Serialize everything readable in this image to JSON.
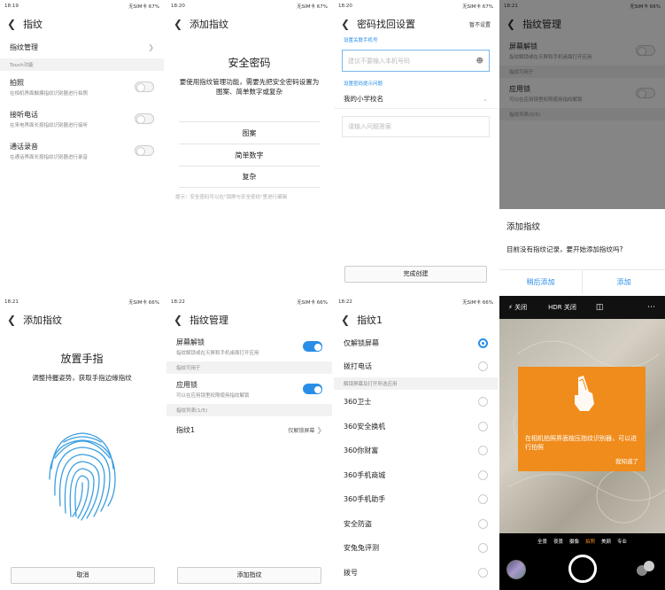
{
  "p1": {
    "time": "18:19",
    "status": "无SIM卡 67%",
    "title": "指纹",
    "item_manage": "指纹管理",
    "section_touch": "Touch功能",
    "items": [
      {
        "label": "拍照",
        "sub": "在相机界面触摸指纹识别器进行拍照"
      },
      {
        "label": "接听电话",
        "sub": "在来电界面长按指纹识别器进行接听"
      },
      {
        "label": "通话录音",
        "sub": "在通话界面长按指纹识别器进行录音"
      }
    ]
  },
  "p2": {
    "time": "18:20",
    "status": "无SIM卡 67%",
    "title": "添加指纹",
    "heading": "安全密码",
    "desc": "要使用指纹管理功能，需要先把安全密码设置为图案、简单数字或复杂",
    "options": [
      "图案",
      "简单数字",
      "复杂"
    ],
    "hint": "提示：安全密码可以在\"锁屏与安全密码\"里进行编辑"
  },
  "p3": {
    "time": "18:20",
    "status": "无SIM卡 67%",
    "title": "密码找回设置",
    "skip": "暂不设置",
    "phone_label": "设置关联手机号",
    "phone_placeholder": "建议不要输入本机号码",
    "question_label": "设置密码提示问题",
    "question_value": "我的小学校名",
    "answer_placeholder": "请输入问题答案",
    "done": "完成创建"
  },
  "p4": {
    "time": "18:21",
    "status": "无SIM卡 66%",
    "title": "指纹管理",
    "row1": {
      "label": "屏幕解锁",
      "sub": "指纹解锁或在灭屏和手机桌面打开应用"
    },
    "section1": "指纹可用于",
    "row2": {
      "label": "应用锁",
      "sub": "可以在应用锁里权限使用指纹解锁"
    },
    "section2": "指纹列表(0/5)",
    "dialog_title": "添加指纹",
    "dialog_msg": "目前没有指纹记录，要开始添加指纹吗?",
    "later": "稍后添加",
    "add": "添加"
  },
  "p5": {
    "time": "18:21",
    "status": "无SIM卡 66%",
    "title": "添加指纹",
    "heading": "放置手指",
    "desc": "调整持握姿势，获取手指边缘指纹",
    "cancel": "取消"
  },
  "p6": {
    "time": "18:22",
    "status": "无SIM卡 66%",
    "title": "指纹管理",
    "row1": {
      "label": "屏幕解锁",
      "sub": "指纹解锁或在灭屏和手机桌面打开应用"
    },
    "section1": "指纹可用于",
    "row2": {
      "label": "应用锁",
      "sub": "可以在应用锁里权限使用指纹解锁"
    },
    "section2": "指纹列表(1/5)",
    "fp_name": "指纹1",
    "fp_value": "仅解锁屏幕",
    "add": "添加指纹"
  },
  "p7": {
    "time": "18:22",
    "status": "无SIM卡 66%",
    "title": "指纹1",
    "top": [
      "仅解锁屏幕",
      "拨打电话"
    ],
    "section": "解锁屏幕及打开所选应用",
    "apps": [
      "360卫士",
      "360安全换机",
      "360你财富",
      "360手机商城",
      "360手机助手",
      "安全防盗",
      "安兔兔评测",
      "拨号"
    ]
  },
  "p8": {
    "close": "关闭",
    "hdr": "HDR 关闭",
    "tip": "在相机拍照界面按压指纹识别器，可以进行拍照",
    "ok": "我知道了",
    "modes": [
      "全景",
      "夜景",
      "摄像",
      "拍照",
      "美颜",
      "专业"
    ]
  }
}
